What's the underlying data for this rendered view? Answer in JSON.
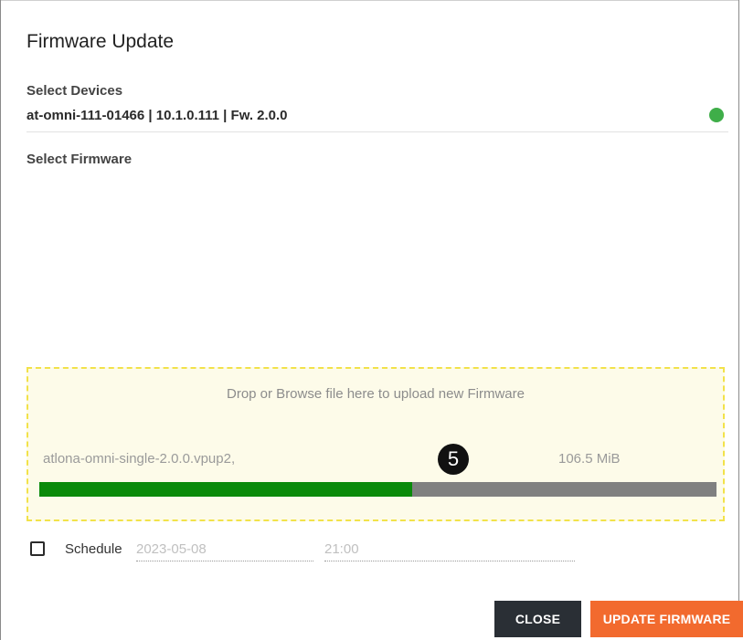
{
  "dialog": {
    "title": "Firmware Update"
  },
  "devices": {
    "label": "Select Devices",
    "selected": "at-omni-111-01466 | 10.1.0.111 | Fw. 2.0.0",
    "status_color": "#3fae49"
  },
  "firmware": {
    "label": "Select Firmware",
    "drop_hint": "Drop or Browse file here to upload new Firmware",
    "file_name": "atlona-omni-single-2.0.0.vpup2,",
    "file_size": "106.5 MiB",
    "upload_progress": 0.55,
    "step_badge": "5"
  },
  "schedule": {
    "checked": false,
    "label": "Schedule",
    "date": "2023-05-08",
    "time": "21:00"
  },
  "buttons": {
    "close": "CLOSE",
    "update": "UPDATE FIRMWARE"
  },
  "colors": {
    "accent": "#f26a2e",
    "dark_button": "#2a2f35",
    "progress_fill": "#0a8a0a",
    "progress_track": "#808080",
    "dropzone_border": "#f2e24a"
  }
}
